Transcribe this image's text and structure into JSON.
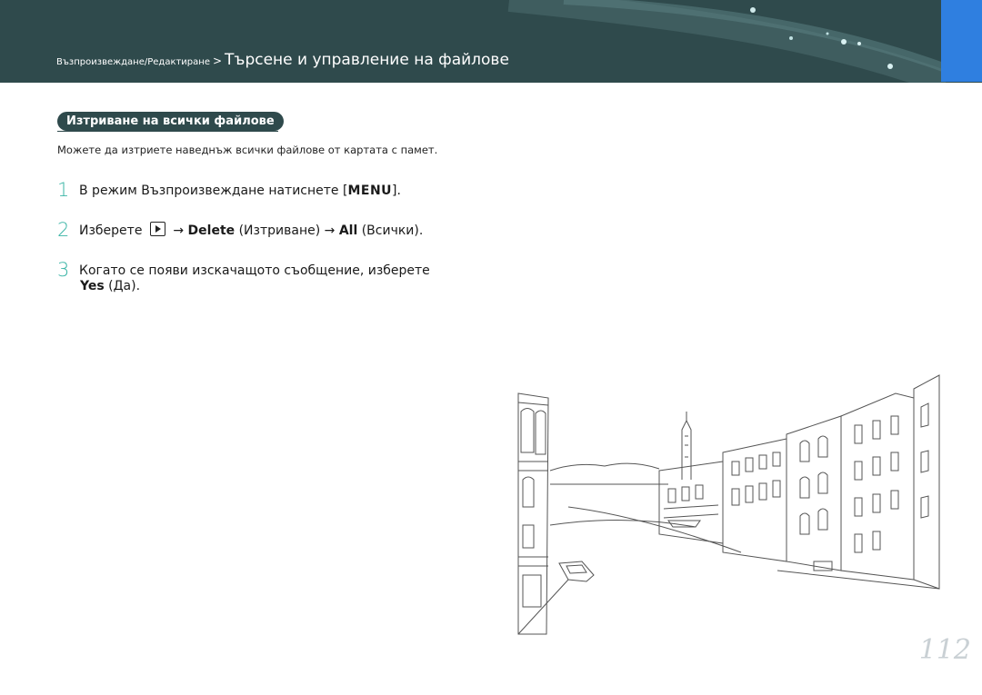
{
  "header": {
    "breadcrumb_section": "Възпроизвеждане/Редактиране",
    "breadcrumb_separator": ">",
    "breadcrumb_title": "Търсене и управление на файлове",
    "accent_color": "#2f4a4c",
    "tab_color": "#2f7fe0"
  },
  "section": {
    "heading": "Изтриване на всички файлове",
    "intro": "Можете да изтриете наведнъж всички файлове от картата с памет."
  },
  "steps": [
    {
      "number": "1",
      "text_before": "В режим Възпроизвеждане натиснете [",
      "key": "MENU",
      "text_after": "]."
    },
    {
      "number": "2",
      "text_before": "Изберете",
      "icon": "playback-icon",
      "arrow1": "→",
      "bold1": "Delete",
      "mid": "(Изтриване)",
      "arrow2": "→",
      "bold2": "All",
      "end": "(Всички)."
    },
    {
      "number": "3",
      "line1": "Когато се появи изскачащото съобщение, изберете",
      "bold": "Yes",
      "end": "(Да)."
    }
  ],
  "page_number": "112",
  "illustration": "venice-canal-line-drawing"
}
